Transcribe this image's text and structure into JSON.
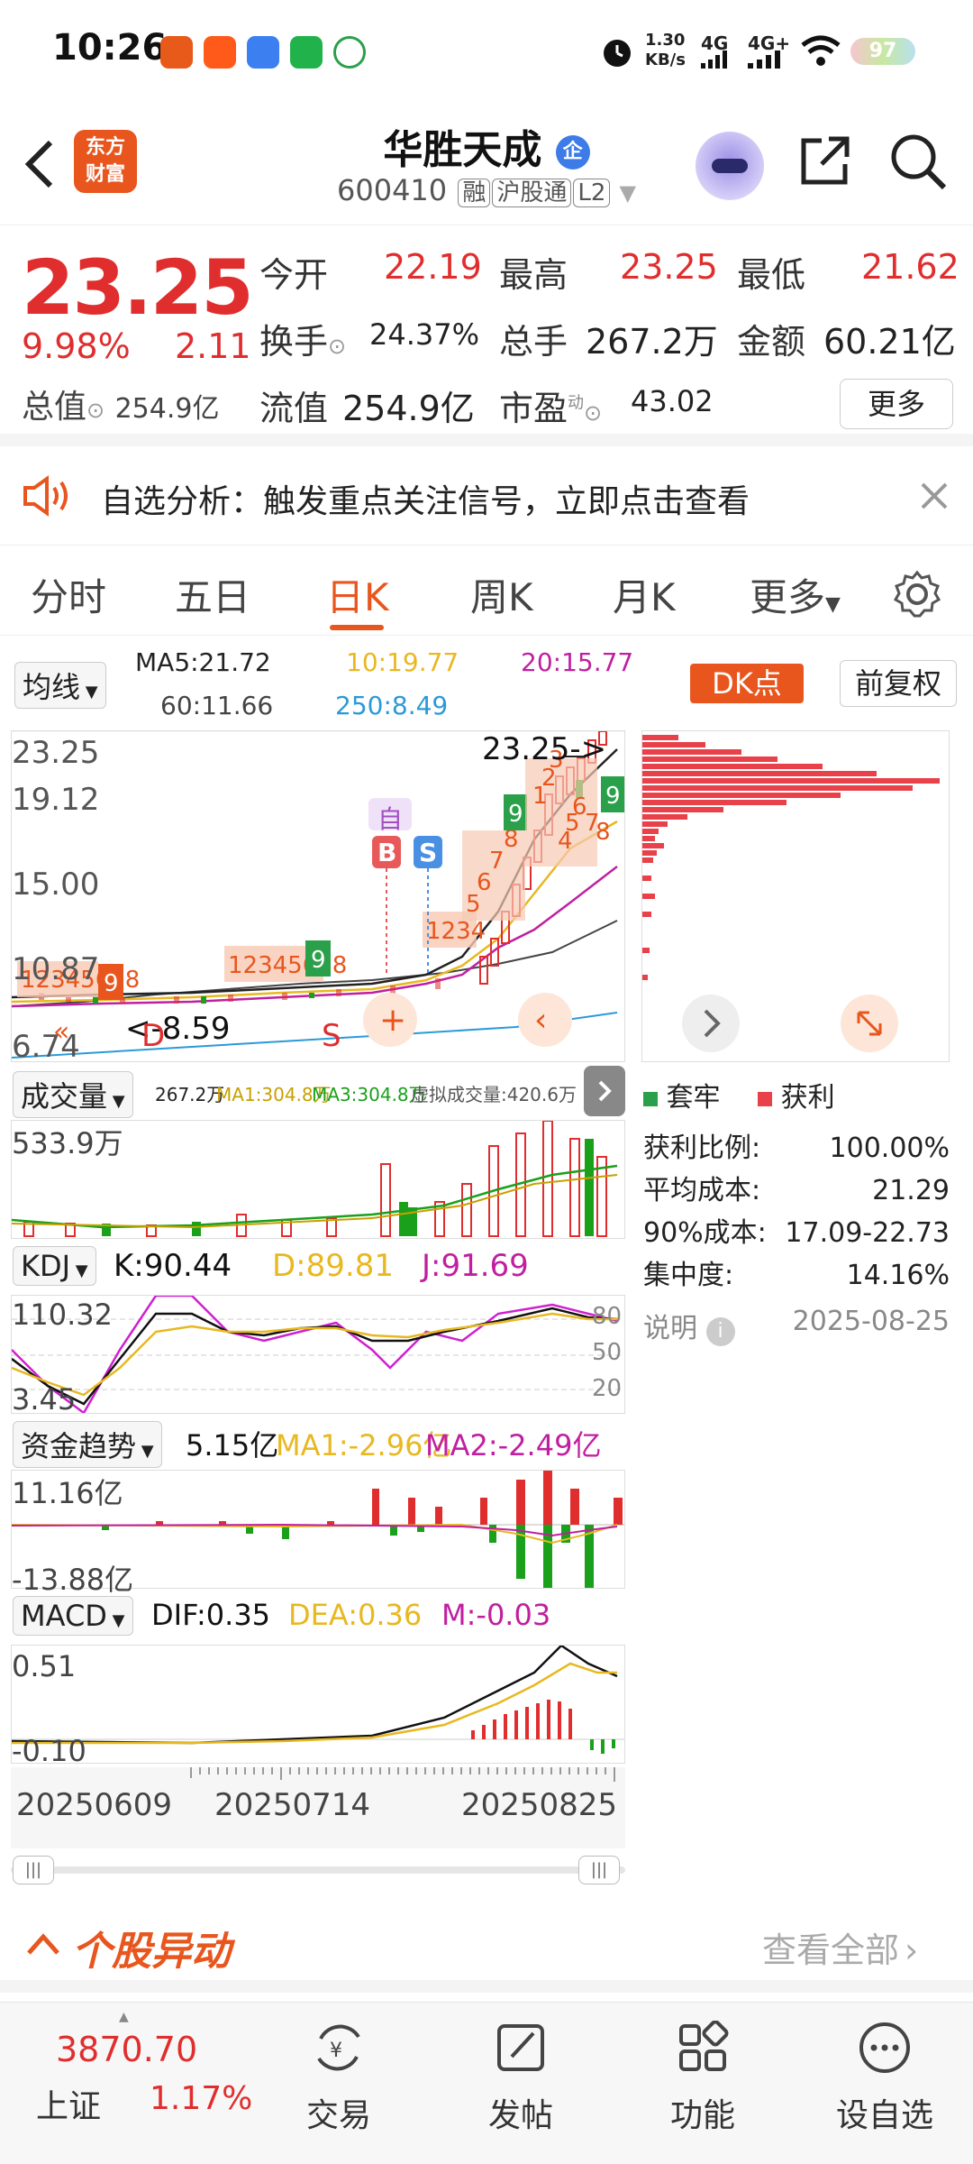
{
  "status_bar": {
    "time": "10:26",
    "speed": "1.30",
    "speed_unit": "KB/s",
    "net1": "4G",
    "net2": "4G+",
    "battery": "97"
  },
  "header": {
    "logo_line1": "东方",
    "logo_line2": "财富",
    "stock_name": "华胜天成",
    "badge": "企",
    "code": "600410",
    "tags": [
      "融",
      "沪股通",
      "L2"
    ]
  },
  "quote": {
    "price": "23.25",
    "change_pct": "9.98%",
    "change": "2.11",
    "open_label": "今开",
    "open": "22.19",
    "high_label": "最高",
    "high": "23.25",
    "low_label": "最低",
    "low": "21.62",
    "turnover_label": "换手",
    "turnover": "24.37%",
    "volume_label": "总手",
    "volume": "267.2万",
    "amount_label": "金额",
    "amount": "60.21亿",
    "total_cap_label": "总值",
    "total_cap": "254.9亿",
    "float_cap_label": "流值",
    "float_cap": "254.9亿",
    "pe_label": "市盈",
    "pe_sup": "动",
    "pe": "43.02",
    "more": "更多"
  },
  "notice": {
    "text": "自选分析：触发重点关注信号，立即点击查看"
  },
  "tabs": [
    "分时",
    "五日",
    "日K",
    "周K",
    "月K",
    "更多"
  ],
  "ma_bar": {
    "selector": "均线",
    "ma5": "MA5:21.72",
    "ma10": "10:19.77",
    "ma20": "20:15.77",
    "ma60": "60:11.66",
    "ma250": "250:8.49",
    "dk": "DK点",
    "fq": "前复权"
  },
  "kline": {
    "y_labels": [
      "23.25",
      "19.12",
      "15.00",
      "10.87",
      "6.74"
    ],
    "high_mark": "23.25",
    "low_mark": "8.59",
    "zi": "自",
    "b": "B",
    "s": "S",
    "d": "D",
    "s2": "S"
  },
  "chip": {
    "legend_taolao": "套牢",
    "legend_huoli": "获利",
    "rows": [
      {
        "label": "获利比例:",
        "value": "100.00%"
      },
      {
        "label": "平均成本:",
        "value": "21.29"
      },
      {
        "label": "90%成本:",
        "value": "17.09-22.73"
      },
      {
        "label": "集中度:",
        "value": "14.16%"
      }
    ],
    "note_label": "说明",
    "date": "2025-08-25"
  },
  "volume": {
    "selector": "成交量",
    "v": "267.2万",
    "ma1": "MA1:304.8万",
    "ma3": "MA3:304.8万",
    "virt": "虚拟成交量:420.6万",
    "ymax": "533.9万"
  },
  "kdj": {
    "selector": "KDJ",
    "k": "K:90.44",
    "d": "D:89.81",
    "j": "J:91.69",
    "ymax": "110.32",
    "ymin": "3.45",
    "l80": "80",
    "l50": "50",
    "l20": "20"
  },
  "fund": {
    "selector": "资金趋势",
    "v": "5.15亿",
    "ma1": "MA1:-2.96亿",
    "ma2": "MA2:-2.49亿",
    "ymax": "11.16亿",
    "ymin": "-13.88亿"
  },
  "macd": {
    "selector": "MACD",
    "dif": "DIF:0.35",
    "dea": "DEA:0.36",
    "m": "M:-0.03",
    "ymax": "0.51",
    "ymin": "-0.10"
  },
  "dates": [
    "20250609",
    "20250714",
    "20250825"
  ],
  "movement": {
    "title": "个股异动",
    "view_all": "查看全部"
  },
  "bottom_nav": {
    "index_value": "3870.70",
    "index_name": "上证",
    "index_pct": "1.17%",
    "trade": "交易",
    "post": "发帖",
    "func": "功能",
    "watch": "设自选"
  },
  "colors": {
    "up": "#e02e2e",
    "down": "#1aa01a",
    "accent": "#e8561e"
  }
}
